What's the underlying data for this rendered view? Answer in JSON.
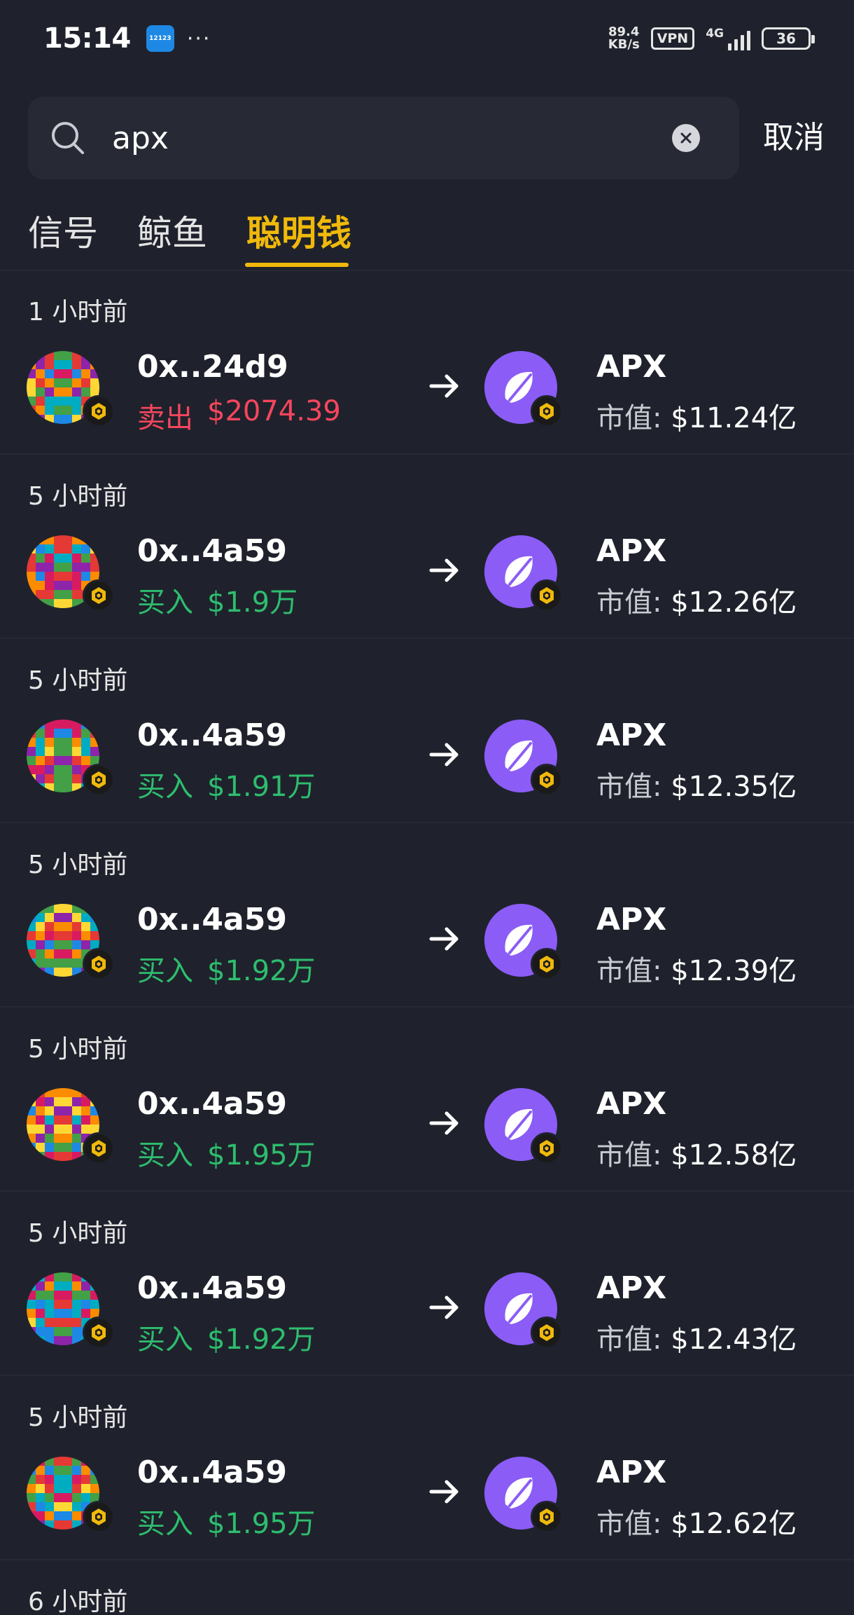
{
  "status_bar": {
    "time": "15:14",
    "app_badge": "12123",
    "dots": "···",
    "net_speed_value": "89.4",
    "net_speed_unit": "KB/s",
    "vpn": "VPN",
    "network": "4G",
    "battery": "36"
  },
  "search": {
    "value": "apx",
    "placeholder": "",
    "cancel_label": "取消"
  },
  "tabs": [
    {
      "label": "信号",
      "active": false
    },
    {
      "label": "鲸鱼",
      "active": false
    },
    {
      "label": "聪明钱",
      "active": true
    }
  ],
  "colors": {
    "accent": "#f0b90b",
    "sell": "#f6465d",
    "buy": "#2ebd6e",
    "token_purple": "#8b5cf6",
    "background": "#1f222c"
  },
  "items": [
    {
      "time": "1 小时前",
      "wallet": "0x..24d9",
      "action": "卖出",
      "side": "sell",
      "amount": "$2074.39",
      "token": "APX",
      "mcap_label": "市值:",
      "mcap": "$11.24亿"
    },
    {
      "time": "5 小时前",
      "wallet": "0x..4a59",
      "action": "买入",
      "side": "buy",
      "amount": "$1.9万",
      "token": "APX",
      "mcap_label": "市值:",
      "mcap": "$12.26亿"
    },
    {
      "time": "5 小时前",
      "wallet": "0x..4a59",
      "action": "买入",
      "side": "buy",
      "amount": "$1.91万",
      "token": "APX",
      "mcap_label": "市值:",
      "mcap": "$12.35亿"
    },
    {
      "time": "5 小时前",
      "wallet": "0x..4a59",
      "action": "买入",
      "side": "buy",
      "amount": "$1.92万",
      "token": "APX",
      "mcap_label": "市值:",
      "mcap": "$12.39亿"
    },
    {
      "time": "5 小时前",
      "wallet": "0x..4a59",
      "action": "买入",
      "side": "buy",
      "amount": "$1.95万",
      "token": "APX",
      "mcap_label": "市值:",
      "mcap": "$12.58亿"
    },
    {
      "time": "5 小时前",
      "wallet": "0x..4a59",
      "action": "买入",
      "side": "buy",
      "amount": "$1.92万",
      "token": "APX",
      "mcap_label": "市值:",
      "mcap": "$12.43亿"
    },
    {
      "time": "5 小时前",
      "wallet": "0x..4a59",
      "action": "买入",
      "side": "buy",
      "amount": "$1.95万",
      "token": "APX",
      "mcap_label": "市值:",
      "mcap": "$12.62亿"
    }
  ],
  "partial_item": {
    "time": "6 小时前"
  }
}
